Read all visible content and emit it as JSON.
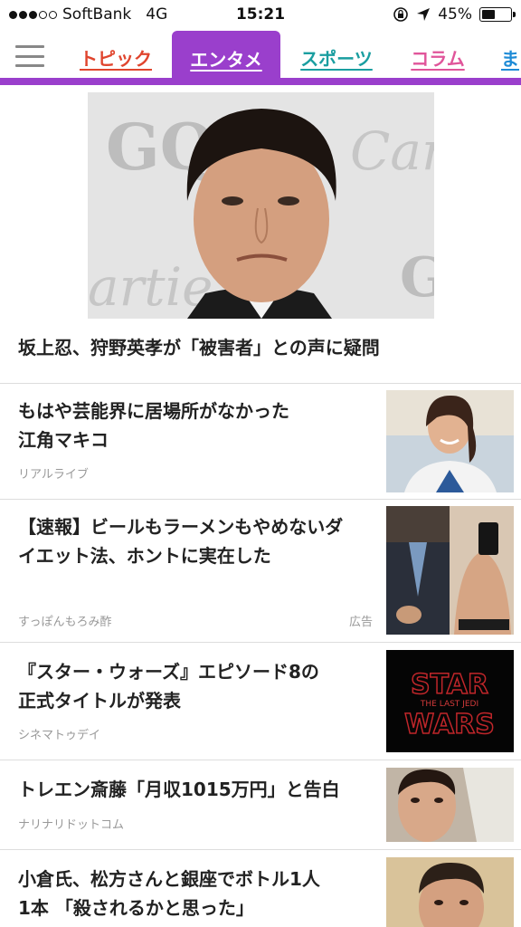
{
  "status_bar": {
    "carrier": "SoftBank",
    "network": "4G",
    "time": "15:21",
    "battery": "45%",
    "battery_level": 0.45
  },
  "tabs": [
    {
      "label": "トピック",
      "color": "#e0452e"
    },
    {
      "label": "エンタメ",
      "color": "#ffffff",
      "active": true
    },
    {
      "label": "スポーツ",
      "color": "#1a9ea0"
    },
    {
      "label": "コラム",
      "color": "#e0559a"
    },
    {
      "label": "ま",
      "color": "#1f8bd6"
    }
  ],
  "accent_color": "#9a3fcc",
  "hero": {
    "title": "坂上忍、狩野英孝が「被害者」との声に疑問"
  },
  "articles": [
    {
      "title_line1": "もはや芸能界に居場所がなかった",
      "title_line2": "江角マキコ",
      "source": "リアルライブ",
      "ad": ""
    },
    {
      "title_line1": "【速報】ビールもラーメンもやめないダ",
      "title_line2": "イエット法、ホントに実在した",
      "source": "すっぽんもろみ酢",
      "ad": "広告"
    },
    {
      "title_line1": "『スター・ウォーズ』エピソード8の",
      "title_line2": "正式タイトルが発表",
      "source": "シネマトゥデイ",
      "ad": "",
      "thumb_text_1": "STAR",
      "thumb_text_2": "THE LAST JEDI",
      "thumb_text_3": "WARS"
    },
    {
      "title_line1": "トレエン斎藤「月収1015万円」と告白",
      "title_line2": "",
      "source": "ナリナリドットコム",
      "ad": ""
    },
    {
      "title_line1": "小倉氏、松方さんと銀座でボトル1人",
      "title_line2": "1本 「殺されるかと思った」",
      "source": "",
      "ad": ""
    }
  ]
}
